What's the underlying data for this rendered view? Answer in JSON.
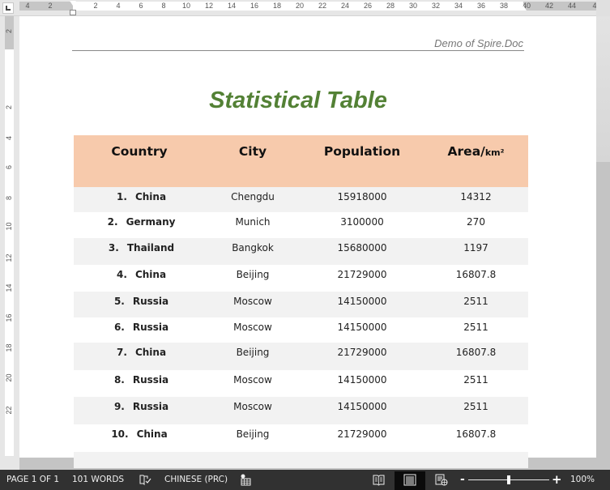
{
  "ruler": {
    "horizontal_ticks": [
      "4",
      "2",
      "2",
      "4",
      "6",
      "8",
      "10",
      "12",
      "14",
      "16",
      "18",
      "20",
      "22",
      "24",
      "26",
      "28",
      "30",
      "32",
      "34",
      "36",
      "38",
      "40",
      "42",
      "44",
      "4"
    ],
    "vertical_ticks": [
      "2",
      "2",
      "4",
      "6",
      "8",
      "10",
      "12",
      "14",
      "16",
      "18",
      "20",
      "22"
    ]
  },
  "document": {
    "header_text": "Demo of Spire.Doc",
    "title": "Statistical Table",
    "title_color": "#538135",
    "table": {
      "header_bg": "#f7caac",
      "stripe_bg": "#f2f2f2",
      "columns": [
        "Country",
        "City",
        "Population",
        "Area/"
      ],
      "area_unit": "km²",
      "rows": [
        {
          "num": "1.",
          "country": "China",
          "city": "Chengdu",
          "population": "15918000",
          "area": "14312"
        },
        {
          "num": "2.",
          "country": "Germany",
          "city": "Munich",
          "population": "3100000",
          "area": "270"
        },
        {
          "num": "3.",
          "country": "Thailand",
          "city": "Bangkok",
          "population": "15680000",
          "area": "1197"
        },
        {
          "num": "4.",
          "country": "China",
          "city": "Beijing",
          "population": "21729000",
          "area": "16807.8"
        },
        {
          "num": "5.",
          "country": "Russia",
          "city": "Moscow",
          "population": "14150000",
          "area": "2511"
        },
        {
          "num": "6.",
          "country": "Russia",
          "city": "Moscow",
          "population": "14150000",
          "area": "2511"
        },
        {
          "num": "7.",
          "country": "China",
          "city": "Beijing",
          "population": "21729000",
          "area": "16807.8"
        },
        {
          "num": "8.",
          "country": "Russia",
          "city": "Moscow",
          "population": "14150000",
          "area": "2511"
        },
        {
          "num": "9.",
          "country": "Russia",
          "city": "Moscow",
          "population": "14150000",
          "area": "2511"
        },
        {
          "num": "10.",
          "country": "China",
          "city": "Beijing",
          "population": "21729000",
          "area": "16807.8"
        }
      ]
    }
  },
  "status_bar": {
    "page": "PAGE 1 OF 1",
    "words": "101 WORDS",
    "proofing_icon": "proofing-book-check-icon",
    "language": "CHINESE (PRC)",
    "macro_icon": "track-changes-icon",
    "views": [
      "read-mode-icon",
      "print-layout-icon",
      "web-layout-icon"
    ],
    "active_view": "print-layout",
    "zoom_minus": "-",
    "zoom_plus": "+",
    "zoom_level": "100%",
    "zoom_percent": 100
  }
}
